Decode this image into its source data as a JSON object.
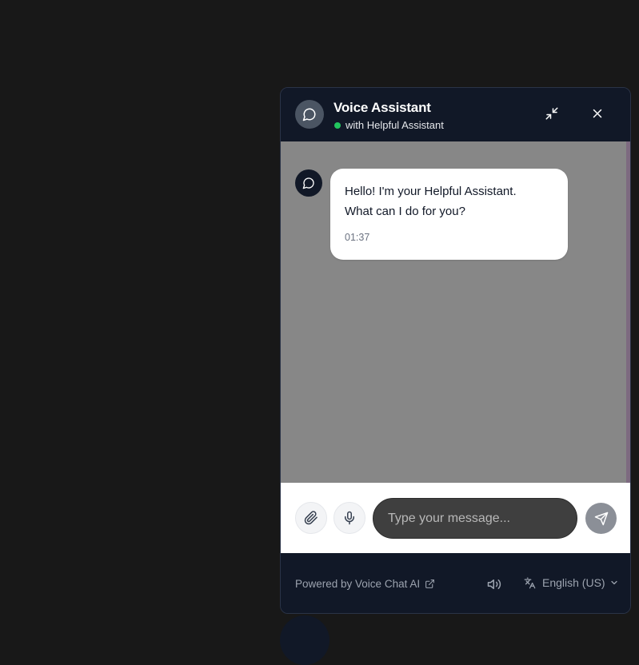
{
  "header": {
    "title": "Voice Assistant",
    "subtitle": "with Helpful Assistant",
    "status_color": "#22c55e",
    "icons": {
      "avatar": "chat-bubble-icon",
      "minimize": "minimize-arrows-icon",
      "close": "close-icon"
    }
  },
  "messages": [
    {
      "sender": "assistant",
      "text": "Hello! I'm your Helpful Assistant.\nWhat can I do for you?",
      "time": "01:37"
    }
  ],
  "composer": {
    "placeholder": "Type your message...",
    "value": "",
    "icons": {
      "attach": "paperclip-icon",
      "mic": "microphone-icon",
      "send": "send-icon"
    }
  },
  "footer": {
    "powered_by": "Powered by Voice Chat AI",
    "language": "English (US)",
    "icons": {
      "external": "external-link-icon",
      "speaker": "speaker-icon",
      "translate": "translate-icon",
      "chevron": "chevron-down-icon"
    }
  },
  "colors": {
    "panel": "#111827",
    "messages_bg": "#878787",
    "bubble": "#ffffff",
    "input_bg": "#3f3f3f",
    "send_bg": "#8b8f97"
  }
}
